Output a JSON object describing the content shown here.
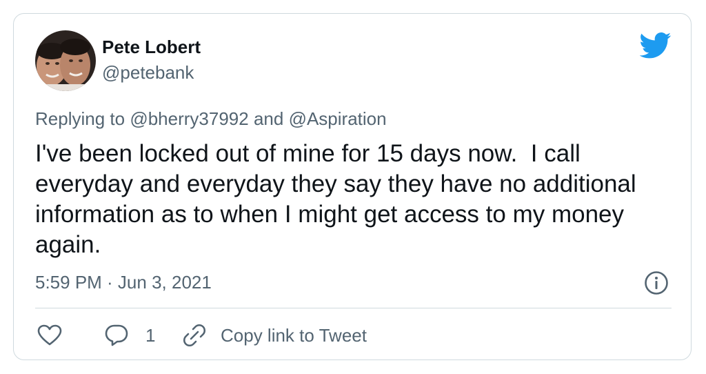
{
  "author": {
    "name": "Pete Lobert",
    "handle": "@petebank"
  },
  "reply_context": {
    "prefix": "Replying to",
    "mention_1": "@bherry37992",
    "conjunction": "and",
    "mention_2": "@Aspiration"
  },
  "tweet": {
    "text": "I've been locked out of mine for 15 days now.  I call everyday and everyday they say they have no additional information as to when I might get access to my money again.",
    "timestamp": "5:59 PM · Jun 3, 2021"
  },
  "actions": {
    "like_icon": "heart-icon",
    "reply_icon": "speech-bubble-icon",
    "reply_count": "1",
    "copy_icon": "link-icon",
    "copy_label": "Copy link to Tweet"
  },
  "colors": {
    "brand_blue": "#1d9bf0",
    "text_primary": "#0f1419",
    "text_secondary": "#536471",
    "border": "#cfd9de"
  }
}
